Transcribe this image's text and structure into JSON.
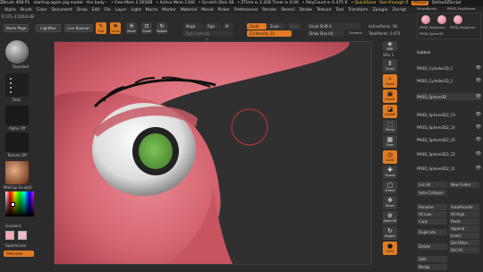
{
  "titlebar": {
    "app": "ZBrush 4R8 P1",
    "doc": "starting again pig model - the body -",
    "free_mem": "• Free Mem 1.565KB",
    "active_mem": "• Active Mem 1340",
    "scratch": "• Scratch Disk 48",
    "ztime": "• ZTime ⊳ 2.428 Timer ⊳ 0.00",
    "poly_count": "• PolyCount ⊳ 0.475 K",
    "quicksave": "• QuickSave",
    "see_through": "See-through  0",
    "menus_btn": "Menus",
    "default_script": "DefaultZScript"
  },
  "menu": [
    "Alpha",
    "Brush",
    "Color",
    "Document",
    "Draw",
    "Edit",
    "File",
    "Layer",
    "Light",
    "Macro",
    "Marker",
    "Material",
    "Movie",
    "Picker",
    "Preferences",
    "Render",
    "Stencil",
    "Stroke",
    "Texture",
    "Tool",
    "Transform",
    "Zplugin",
    "Zscript"
  ],
  "coords": "0.171,-2.226,0.48",
  "top_left_buttons": {
    "home": "Home Page",
    "lightbox": "LightBox",
    "live_boolean": "Live Boolean"
  },
  "tools": [
    {
      "icon": "✎",
      "label": "Edit",
      "active": true
    },
    {
      "icon": "✥",
      "label": "Draw",
      "active": true
    },
    {
      "icon": "✣",
      "label": "Move",
      "active": false
    },
    {
      "icon": "⊡",
      "label": "Scale",
      "active": false
    },
    {
      "icon": "↻",
      "label": "Rotate",
      "active": false
    }
  ],
  "draw_controls": {
    "mrgb": "Mrgb",
    "rgb": "Rgb",
    "m": "M",
    "zadd": "Zadd",
    "zsub": "Zsub",
    "zcut": "Zcut",
    "focal_shift": "Focal Shift 0",
    "draw_size": "Draw Size 64",
    "dynamic": "Dynamic",
    "rgb_intensity": "Rgb Intensity",
    "z_intensity": "Z Intensity 25",
    "active_points": "ActivePoints: 5K",
    "total_points": "TotalPoints: 0.475"
  },
  "left_panel": {
    "brush_name": "Standard",
    "stroke_name": "Dots",
    "alpha_name": "Alpha Off",
    "texture_name": "Texture Off",
    "material_name": "MatCap Sculpt2",
    "gradient": "Gradient",
    "switch_color": "SwitchColor",
    "alternate": "Alternate"
  },
  "right_strip": [
    {
      "label": "BPR",
      "icon": "◈",
      "color": "gray"
    },
    {
      "label": "SPix 3",
      "icon": "",
      "color": "gray"
    },
    {
      "label": "Scroll",
      "icon": "⇕",
      "color": "gray"
    },
    {
      "label": "Zoom",
      "icon": "⌕",
      "color": "orange"
    },
    {
      "label": "Actual",
      "icon": "▣",
      "color": "orange"
    },
    {
      "label": "AAHalf",
      "icon": "◪",
      "color": "orange"
    },
    {
      "label": "Persp",
      "icon": "⬚",
      "color": "gray"
    },
    {
      "label": "Floor",
      "icon": "▦",
      "color": "gray"
    },
    {
      "label": "Local",
      "icon": "◎",
      "color": "orange"
    },
    {
      "label": "Gizmo",
      "icon": "✚",
      "color": "gray"
    },
    {
      "label": "Frame",
      "icon": "▢",
      "color": "gray"
    },
    {
      "label": "Move",
      "icon": "✥",
      "color": "gray"
    },
    {
      "label": "Zoom3D",
      "icon": "⊕",
      "color": "gray"
    },
    {
      "label": "Rotate",
      "icon": "↻",
      "color": "gray"
    },
    {
      "label": "Line Fill",
      "icon": "▤",
      "color": "gray"
    },
    {
      "label": "Transp",
      "icon": "◫",
      "color": "gray"
    },
    {
      "label": "Ghost",
      "icon": "◌",
      "color": "gray"
    },
    {
      "label": "Solo",
      "icon": "●",
      "color": "orange"
    },
    {
      "label": "Xpose",
      "icon": "⊞",
      "color": "gray"
    }
  ],
  "tool_thumbs": {
    "top_label_1": "SimpleBrush",
    "top_label_2": "PM3D_PolySphere",
    "bottom_label_1": "PM3D_PolySphere",
    "bottom_label_2": "PM3D_PolySphere",
    "active_label": "PM3D_Sphere3D"
  },
  "subtool": {
    "title": "Subtool",
    "items": [
      "PM3D_Cylinder3D_1",
      "PM3D_Cylinder3D_2",
      "PM3D_Sphere3D",
      "PM3D_Sphere3D2_13",
      "PM3D_Sphere3D2_14",
      "PM3D_Sphere3D2_15",
      "PM3D_Sphere3D2_12",
      "PM3D_Sphere3D2_11"
    ],
    "list_all": "List All",
    "new_folder": "New Folder",
    "auto_collapse": "Auto Collapse",
    "rename": "Rename",
    "auto_reorder": "AutoReorder",
    "all_low": "All Low",
    "all_high": "All High",
    "copy": "Copy",
    "paste": "Paste",
    "append": "Append",
    "duplicate": "Duplicate",
    "insert": "Insert",
    "del_other": "Del Other",
    "delete": "Delete",
    "del_all": "Del All",
    "split": "Split",
    "merge": "Merge"
  },
  "colors": {
    "accent": "#e07b22",
    "skin": "#d9707a",
    "iris": "#6fae4a"
  }
}
